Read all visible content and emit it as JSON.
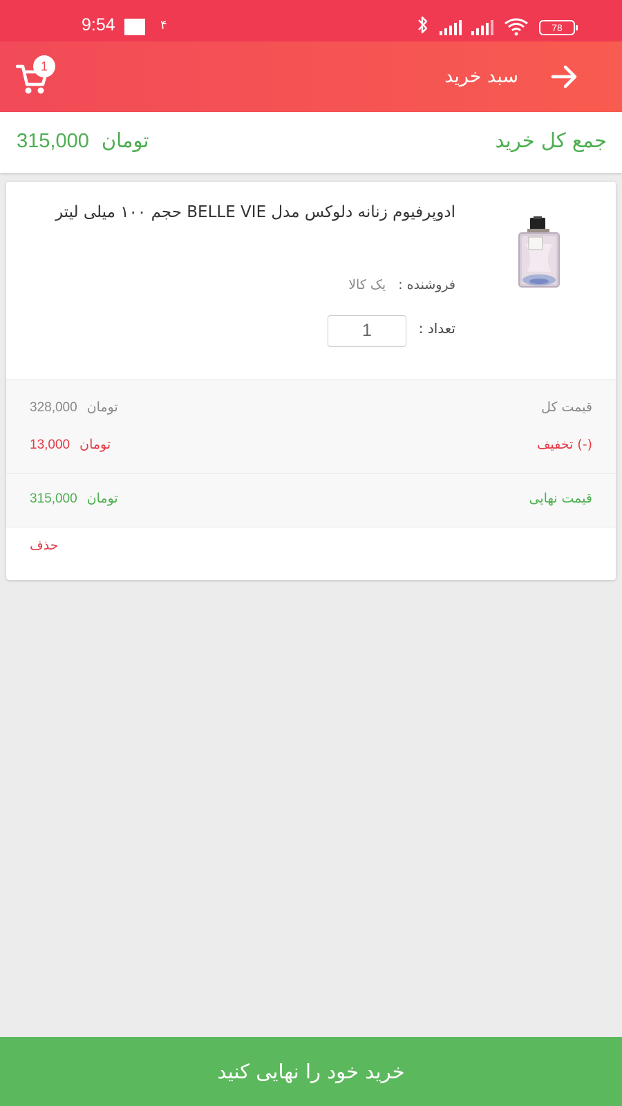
{
  "status_bar": {
    "time": "9:54",
    "extra_indicator": "۴",
    "battery_level": "78"
  },
  "app_bar": {
    "title": "سبد خرید",
    "cart_badge_count": "1"
  },
  "summary": {
    "label": "جمع کل خرید",
    "amount": "315,000",
    "currency": "تومان"
  },
  "cart_items": [
    {
      "title": "ادوپرفیوم زنانه دلوکس مدل BELLE VIE حجم ۱۰۰ میلی لیتر",
      "seller_label": "فروشنده :",
      "seller_name": "یک کالا",
      "quantity_label": "تعداد :",
      "quantity": "1",
      "total_price_label": "قیمت کل",
      "total_price": "328,000",
      "discount_label": "(-) تخفیف",
      "discount": "13,000",
      "final_price_label": "قیمت نهایی",
      "final_price": "315,000",
      "currency": "تومان",
      "delete_label": "حذف"
    }
  ],
  "checkout_button": "خرید خود را نهایی کنید",
  "colors": {
    "status_bar": "#f03a52",
    "app_bar": "#f85b50",
    "accent_green": "#4caf50",
    "checkout": "#5cb85c",
    "discount_red": "#e53945",
    "background": "#ececec"
  }
}
